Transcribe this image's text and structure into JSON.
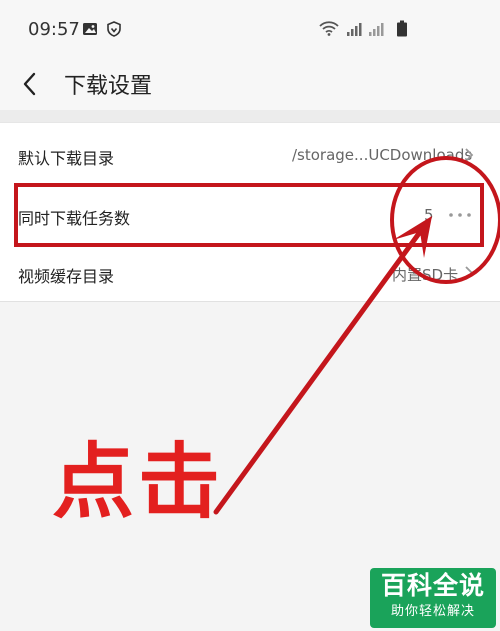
{
  "status_bar": {
    "time": "09:57"
  },
  "header": {
    "title": "下载设置"
  },
  "settings": {
    "download_dir": {
      "label": "默认下载目录",
      "value": "/storage...UCDownloads"
    },
    "concurrent_tasks": {
      "label": "同时下载任务数",
      "value": "5"
    },
    "video_cache_dir": {
      "label": "视频缓存目录",
      "value": "内置SD卡"
    }
  },
  "annotation": {
    "text": "点击",
    "color": "#e3201f"
  },
  "watermark": {
    "main": "百科全说",
    "sub": "助你轻松解决",
    "color": "#1aa35a"
  },
  "icons": [
    "image-icon",
    "shield-icon",
    "wifi-icon",
    "signal-icon",
    "battery-icon",
    "back-icon",
    "chevron-right-icon",
    "more-dots-icon"
  ]
}
